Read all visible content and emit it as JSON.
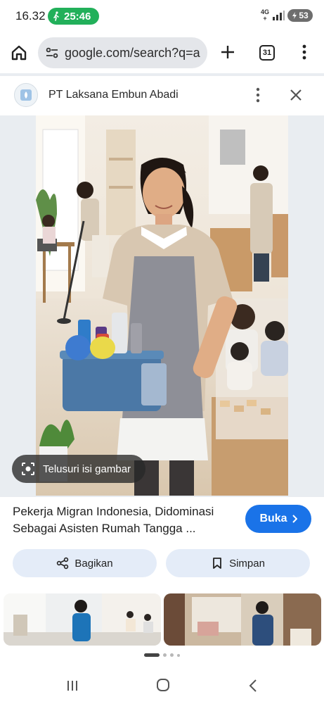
{
  "status_bar": {
    "time": "16.32",
    "walk_timer": "25:46",
    "network_top": "4G",
    "network_bottom": "+",
    "battery": "53"
  },
  "toolbar": {
    "url": "google.com/search?q=a",
    "tab_count": "31"
  },
  "source": {
    "name": "PT Laksana Embun Abadi"
  },
  "image": {
    "lens_label": "Telusuri isi gambar"
  },
  "result": {
    "title": "Pekerja Migran Indonesia, Didominasi Sebagai Asisten Rumah Tangga ...",
    "open_label": "Buka"
  },
  "actions": {
    "share_label": "Bagikan",
    "save_label": "Simpan"
  },
  "carousel": {
    "active_page": 1,
    "page_count": 4
  },
  "colors": {
    "accent": "#1a73e8",
    "walk_pill": "#22b05a",
    "action_bg": "#e4ecf8",
    "backdrop": "#e9edf1"
  },
  "icons": [
    "walk-icon",
    "home-icon",
    "tune-icon",
    "plus-icon",
    "menu-icon",
    "more-vert-icon",
    "close-icon",
    "lens-icon",
    "chevron-right-icon",
    "share-icon",
    "bookmark-icon",
    "nav-recent-icon",
    "nav-home-icon",
    "nav-back-icon"
  ]
}
